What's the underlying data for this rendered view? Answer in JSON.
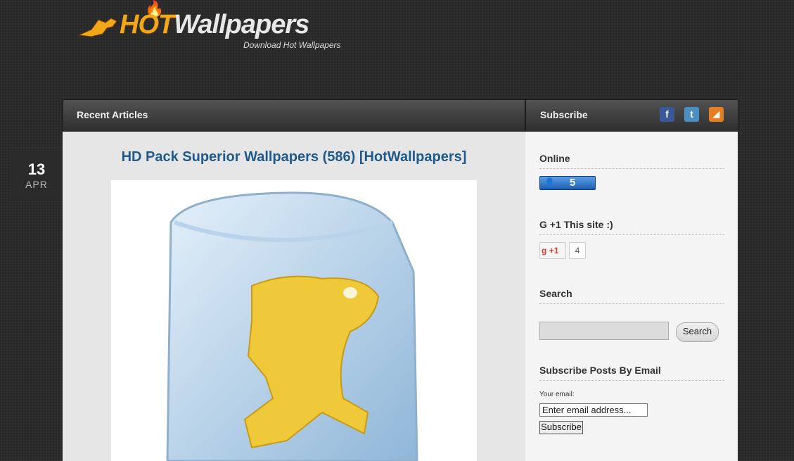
{
  "logo": {
    "hot": "HOT",
    "wallpapers": "Wallpapers",
    "tagline": "Download Hot Wallpapers"
  },
  "header": {
    "recent_articles": "Recent Articles",
    "subscribe": "Subscribe",
    "social": [
      {
        "icon": "facebook-icon",
        "glyph": "f",
        "color": "#3b5998"
      },
      {
        "icon": "twitter-icon",
        "glyph": "t",
        "color": "#4a8fc4"
      },
      {
        "icon": "rss-icon",
        "glyph": "◢",
        "color": "#e67e22"
      }
    ]
  },
  "post": {
    "date_day": "13",
    "date_month": "APR",
    "title": "HD Pack Superior Wallpapers (586) [HotWallpapers]"
  },
  "sidebar": {
    "online": {
      "title": "Online",
      "count": "5"
    },
    "gplus": {
      "title": "G +1 This site :)",
      "button": "+1",
      "count": "4"
    },
    "search": {
      "title": "Search",
      "button": "Search",
      "value": ""
    },
    "email": {
      "title": "Subscribe Posts By Email",
      "label": "Your email:",
      "placeholder": "Enter email address...",
      "button": "Subscribe"
    }
  }
}
